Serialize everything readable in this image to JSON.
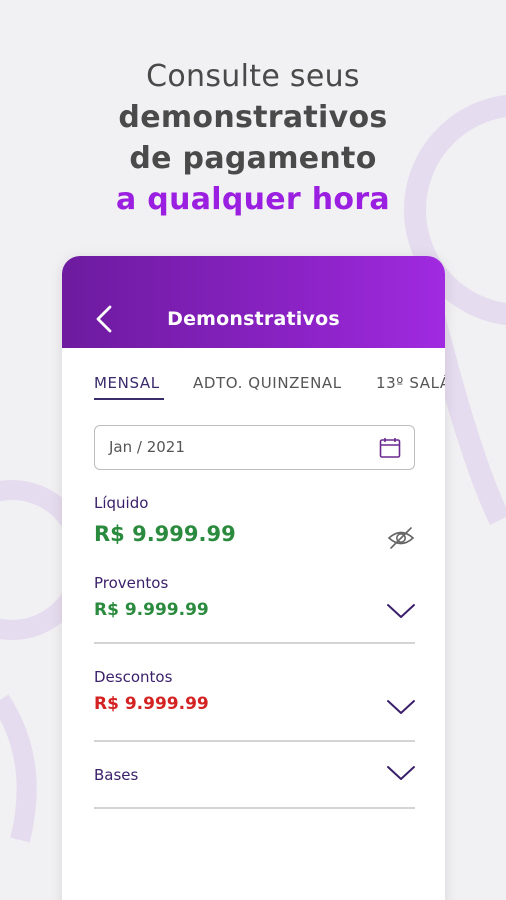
{
  "headline": {
    "line1": "Consulte seus",
    "line2": "demonstrativos",
    "line3": "de pagamento",
    "line4": "a qualquer hora"
  },
  "appbar": {
    "title": "Demonstrativos",
    "back_icon": "chevron-left-icon"
  },
  "tabs": [
    {
      "label": "MENSAL",
      "active": true
    },
    {
      "label": "ADTO. QUINZENAL",
      "active": false
    },
    {
      "label": "13º SALÁ",
      "active": false
    }
  ],
  "date_field": {
    "value": "Jan / 2021",
    "icon": "calendar-icon"
  },
  "liquido": {
    "label": "Líquido",
    "value": "R$ 9.999.99",
    "icon": "eye-off-icon"
  },
  "proventos": {
    "label": "Proventos",
    "value": "R$ 9.999.99",
    "icon": "chevron-down-icon"
  },
  "descontos": {
    "label": "Descontos",
    "value": "R$ 9.999.99",
    "icon": "chevron-down-icon"
  },
  "bases": {
    "label": "Bases",
    "icon": "chevron-down-icon"
  },
  "colors": {
    "accent": "#9b1fe0",
    "appbar_start": "#6d1b9f",
    "appbar_end": "#a02ae0",
    "positive": "#2a8a3e",
    "negative": "#d42222",
    "label": "#3a1f6a"
  }
}
